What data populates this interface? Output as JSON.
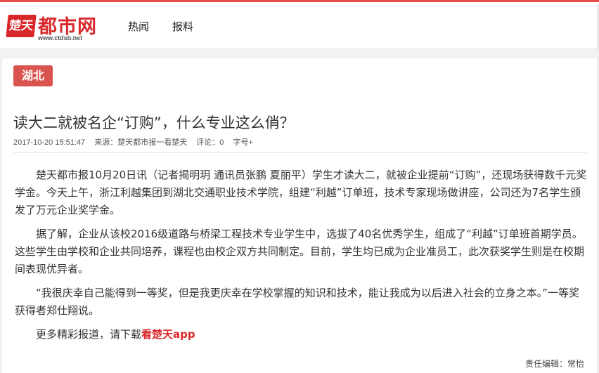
{
  "header": {
    "logo_badge": "楚天",
    "site_name": "都市网",
    "site_url": "www.ctdsb.net",
    "nav": [
      {
        "label": "热闻"
      },
      {
        "label": "报料"
      }
    ]
  },
  "article": {
    "tag": "湖北",
    "title": "读大二就被名企“订购”，什么专业这么俏？",
    "meta": {
      "datetime": "2017-10-20 15:51:47",
      "source": "来源：楚天都市报一看楚天",
      "comments": "评论：0",
      "font_size": "字号+"
    },
    "paragraphs": [
      "楚天都市报10月20日讯（记者揭明玥 通讯员张鹏 夏丽平）学生才读大二，就被企业提前“订购”，还现场获得数千元奖学金。今天上午，浙江利越集团到湖北交通职业技术学院，组建“利越”订单班，技术专家现场做讲座，公司还为7名学生颁发了万元企业奖学金。",
      "据了解，企业从该校2016级道路与桥梁工程技术专业学生中，选拔了40名优秀学生，组成了“利越”订单班首期学员。这些学生由学校和企业共同培养，课程也由校企双方共同制定。目前，学生均已成为企业准员工，此次获奖学生则是在校期间表现优异者。",
      "“我很庆幸自己能得到一等奖，但是我更庆幸在学校掌握的知识和技术，能让我成为以后进入社会的立身之本。”一等奖获得者郑仕翔说。"
    ],
    "more_prefix": "更多精彩报道，请下载",
    "more_link": "看楚天app",
    "editor": "责任编辑：常怡"
  },
  "colors": {
    "brand_red": "#d9282b",
    "tag_red": "#d9534f"
  }
}
